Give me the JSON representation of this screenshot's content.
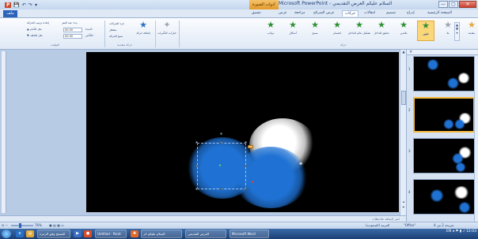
{
  "window": {
    "title": "Microsoft PowerPoint - السلام عليكم العرض التقديمي",
    "contextual_tab": "أدوات الصورة",
    "controls": [
      "—",
      "▢",
      "✕"
    ],
    "quick_access": [
      "💾",
      "↶",
      "↷",
      "▾"
    ]
  },
  "tabs": {
    "file": "ملف",
    "items": [
      "الصفحة الرئيسية",
      "إدراج",
      "تصميم",
      "انتقالات",
      "حركات",
      "عرض الشرائح",
      "مراجعة",
      "عرض",
      "تنسيق"
    ],
    "active": "حركات"
  },
  "ribbon": {
    "preview_label": "معاينة",
    "preview_group": "معاينة",
    "animations": [
      {
        "label": "بلا",
        "selected": false,
        "grey": true
      },
      {
        "label": "ظهور",
        "selected": true,
        "grey": false
      },
      {
        "label": "تلاشي",
        "selected": false,
        "grey": false
      },
      {
        "label": "تحليق للداخل",
        "selected": false,
        "grey": false
      },
      {
        "label": "تشكيل عائم للداخل",
        "selected": false,
        "grey": false
      },
      {
        "label": "انقسام",
        "selected": false,
        "grey": false
      },
      {
        "label": "مسح",
        "selected": false,
        "grey": false
      },
      {
        "label": "أشكال",
        "selected": false,
        "grey": false
      },
      {
        "label": "دولاب",
        "selected": false,
        "grey": false
      }
    ],
    "animation_group_label": "حركة",
    "effect_options": "خيارات التأثيرات",
    "add_animation": "إضافة حركة",
    "advanced_group_label": "حركة متقدمة",
    "animation_pane": "جزء الحركات",
    "trigger": "مشغل",
    "animation_painter": "نسخ الحركة",
    "start_label": "بدء: عند النقر",
    "duration_label": "المدة:",
    "delay_label": "التأخير:",
    "duration_value": "00.50",
    "delay_value": "00.00",
    "reorder_label": "إعادة ترتيب الحركة",
    "move_earlier": "▲ نقل للأمام",
    "move_later": "▼ نقل للخلف",
    "timing_group_label": "التوقيت"
  },
  "slide_panel": {
    "close": "×",
    "thumbnails": [
      {
        "num": "1",
        "selected": false
      },
      {
        "num": "2",
        "selected": true
      },
      {
        "num": "3",
        "selected": false
      },
      {
        "num": "4",
        "selected": false
      }
    ]
  },
  "notes": {
    "placeholder": "انقر لإضافة ملاحظات"
  },
  "status": {
    "slide_info": "شريحة 2 من 4",
    "theme": "\"Office\"",
    "language": "العربية (السعودية)",
    "zoom": "76%"
  },
  "taskbar": {
    "buttons": [
      "التصفح وفق الزمرة",
      "Untitled - Paint",
      "السلام عليكم اثر",
      "العرض التقديمي",
      "Microsoft Word"
    ],
    "tray_lang": "EN",
    "clock": "12:03"
  },
  "colors": {
    "accent": "#2c63b8",
    "blue_circle": "#1f72d4",
    "animation_star": "#2e8f33",
    "selected_gallery": "#fbd77a"
  }
}
